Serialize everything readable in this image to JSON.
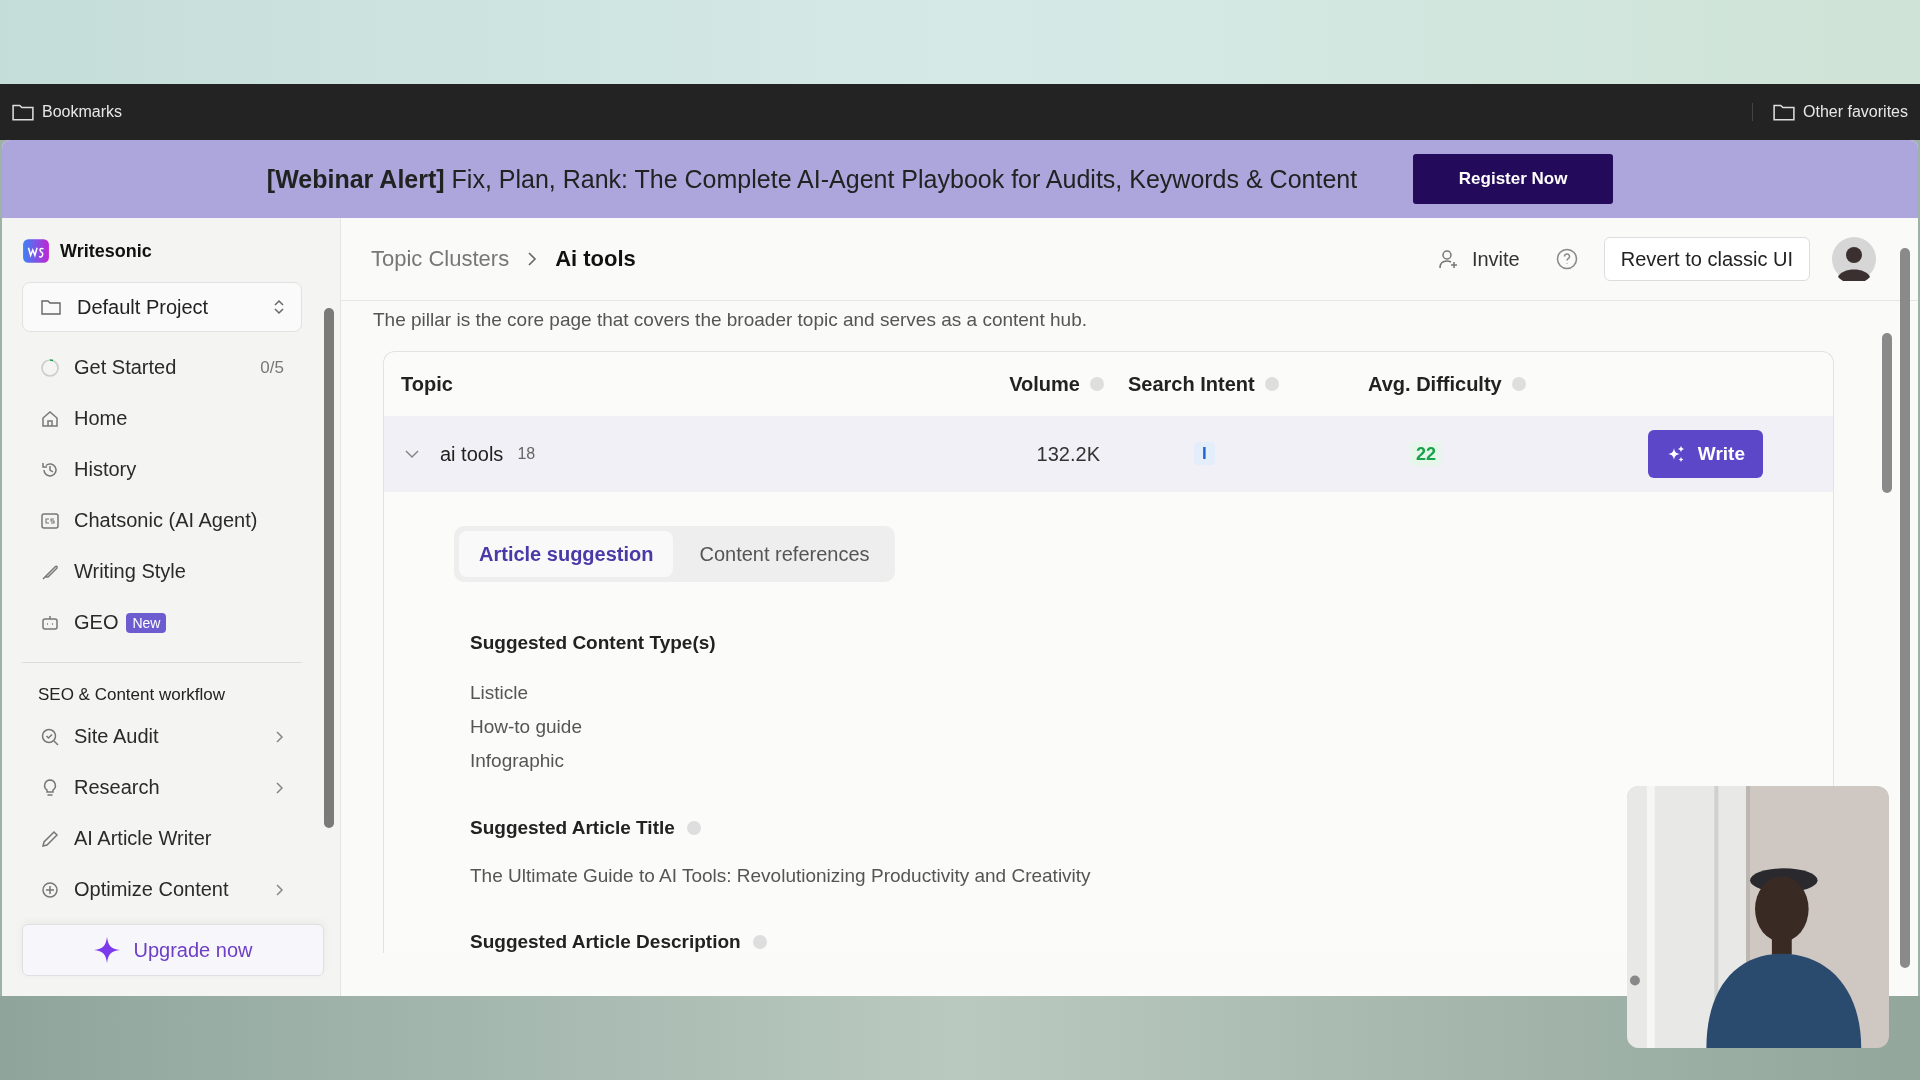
{
  "bookmarks_bar": {
    "left": "Bookmarks",
    "right": "Other favorites"
  },
  "banner": {
    "text": "**[Webinar Alert]** Fix, Plan, Rank: The Complete AI-Agent Playbook for Audits, Keywords & Content",
    "button": "Register Now"
  },
  "sidebar": {
    "brand": "Writesonic",
    "project": "Default Project",
    "items": [
      {
        "label": "Get Started",
        "count": "0/5"
      },
      {
        "label": "Home"
      },
      {
        "label": "History"
      },
      {
        "label": "Chatsonic (AI Agent)"
      },
      {
        "label": "Writing Style"
      },
      {
        "label": "GEO",
        "badge": "New"
      }
    ],
    "section_title": "SEO & Content workflow",
    "workflow_items": [
      {
        "label": "Site Audit",
        "has_submenu": true
      },
      {
        "label": "Research",
        "has_submenu": true
      },
      {
        "label": "AI Article Writer",
        "has_submenu": false
      },
      {
        "label": "Optimize Content",
        "has_submenu": true
      }
    ],
    "upgrade_button": "Upgrade now"
  },
  "header": {
    "breadcrumb": [
      "Topic Clusters",
      "Ai tools"
    ],
    "invite": "Invite",
    "revert_button": "Revert to classic UI"
  },
  "description": "The pillar is the core page that covers the broader topic and serves as a content hub.",
  "table": {
    "columns": [
      {
        "label": "Topic",
        "info": false
      },
      {
        "label": "Volume",
        "info": true
      },
      {
        "label": "Search Intent",
        "info": true
      },
      {
        "label": "Avg. Difficulty",
        "info": true
      }
    ],
    "rows": [
      {
        "topic": "ai tools",
        "count": "18",
        "volume": "132.2K",
        "intent": "I",
        "difficulty": "22",
        "expanded": true,
        "button": "Write"
      }
    ]
  },
  "tabs": [
    {
      "label": "Article suggestion",
      "selected": true
    },
    {
      "label": "Content references",
      "selected": false
    }
  ],
  "sections": [
    {
      "heading": "Suggested Content Type(s)",
      "info": false,
      "items": [
        "Listicle",
        "How-to guide",
        "Infographic"
      ]
    },
    {
      "heading": "Suggested Article Title",
      "info": true,
      "text": "The Ultimate Guide to AI Tools: Revolutionizing Productivity and Creativity"
    },
    {
      "heading": "Suggested Article Description",
      "info": true
    }
  ]
}
